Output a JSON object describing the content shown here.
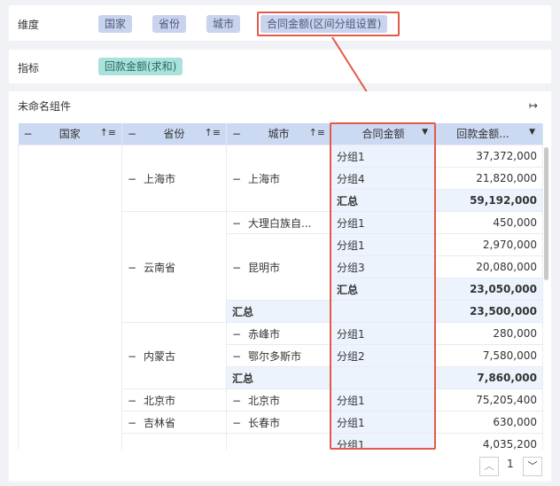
{
  "dimension_bar": {
    "label": "维度",
    "chips": [
      "国家",
      "省份",
      "城市",
      "合同金额(区间分组设置)"
    ]
  },
  "metric_bar": {
    "label": "指标",
    "chips": [
      "回款金额(求和)"
    ]
  },
  "widget": {
    "title": "未命名组件",
    "expand_icon": "↦"
  },
  "table": {
    "headers": [
      "国家",
      "省份",
      "城市",
      "合同金额",
      "回款金额..."
    ],
    "minus": "−",
    "sort_icon": "↑≡",
    "caret": "▼",
    "rows": {
      "r0": {
        "g": "分组1",
        "v": "37,372,000"
      },
      "r1": {
        "g": "分组4",
        "v": "21,820,000"
      },
      "r2": {
        "g": "汇总",
        "v": "59,192,000"
      },
      "r3": {
        "g": "分组1",
        "v": "450,000"
      },
      "r4": {
        "g": "分组1",
        "v": "2,970,000"
      },
      "r5": {
        "g": "分组3",
        "v": "20,080,000"
      },
      "r6": {
        "g": "汇总",
        "v": "23,050,000"
      },
      "r7": {
        "g": "",
        "v": "23,500,000"
      },
      "r8": {
        "g": "分组1",
        "v": "280,000"
      },
      "r9": {
        "g": "分组2",
        "v": "7,580,000"
      },
      "r10": {
        "g": "",
        "v": "7,860,000"
      },
      "r11": {
        "g": "分组1",
        "v": "75,205,400"
      },
      "r12": {
        "g": "分组1",
        "v": "630,000"
      },
      "r13": {
        "g": "分组1",
        "v": "4,035,200"
      }
    },
    "provinces": {
      "shanghai": "上海市",
      "yunnan": "云南省",
      "neimeng": "内蒙古",
      "beijing": "北京市",
      "jilin": "吉林省"
    },
    "cities": {
      "shanghai": "上海市",
      "dali": "大理白族自...",
      "kunming": "昆明市",
      "yunnan_total": "汇总",
      "chifeng": "赤峰市",
      "ordos": "鄂尔多斯市",
      "neimeng_total": "汇总",
      "beijing": "北京市",
      "changchun": "长春市"
    }
  },
  "pagination": {
    "prev": "︿",
    "page": "1",
    "next": "﹀"
  },
  "colors": {
    "highlight": "#e35a4a",
    "header_bg": "#cbd9f3",
    "chip_bg": "#c9d3ee",
    "metric_chip_bg": "#a8e2da"
  }
}
